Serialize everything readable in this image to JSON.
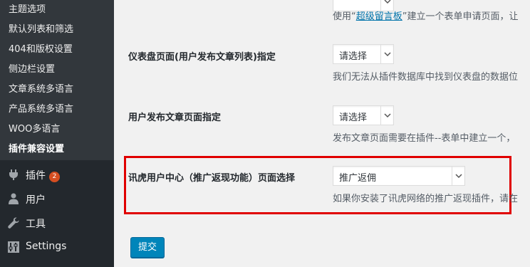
{
  "sidebar": {
    "submenu": [
      {
        "label": "主题选项"
      },
      {
        "label": "默认列表和筛选"
      },
      {
        "label": "404和版权设置"
      },
      {
        "label": "侧边栏设置"
      },
      {
        "label": "文章系统多语言"
      },
      {
        "label": "产品系统多语言"
      },
      {
        "label": "WOO多语言"
      },
      {
        "label": "插件兼容设置"
      }
    ],
    "menu": [
      {
        "label": "插件",
        "badge": "2",
        "icon": "plugins-icon"
      },
      {
        "label": "用户",
        "icon": "user-icon"
      },
      {
        "label": "工具",
        "icon": "wrench-icon"
      },
      {
        "label": "Settings",
        "icon": "settings-icon"
      }
    ]
  },
  "main": {
    "top_desc": {
      "before": "使用“",
      "link": "超级留言板",
      "after": "”建立一个表单申请页面，让"
    },
    "rows": [
      {
        "label": "仪表盘页面(用户发布文章列表)指定",
        "select_value": "请选择",
        "description": "我们无法从插件数据库中找到仪表盘的数据位"
      },
      {
        "label": "用户发布文章页面指定",
        "select_value": "请选择",
        "description": "发布文章页面需要在插件--表单中建立一个，"
      },
      {
        "label": "讯虎用户中心（推广返现功能）页面选择",
        "select_value": "推广返佣",
        "description": "如果你安装了讯虎网络的推广返现插件，请在"
      }
    ],
    "submit_label": "提交"
  },
  "colors": {
    "sidebar_bg": "#23282d",
    "submenu_bg": "#32373c",
    "accent": "#0085ba",
    "badge": "#d54e21",
    "highlight": "#e00000",
    "link": "#0073aa"
  }
}
